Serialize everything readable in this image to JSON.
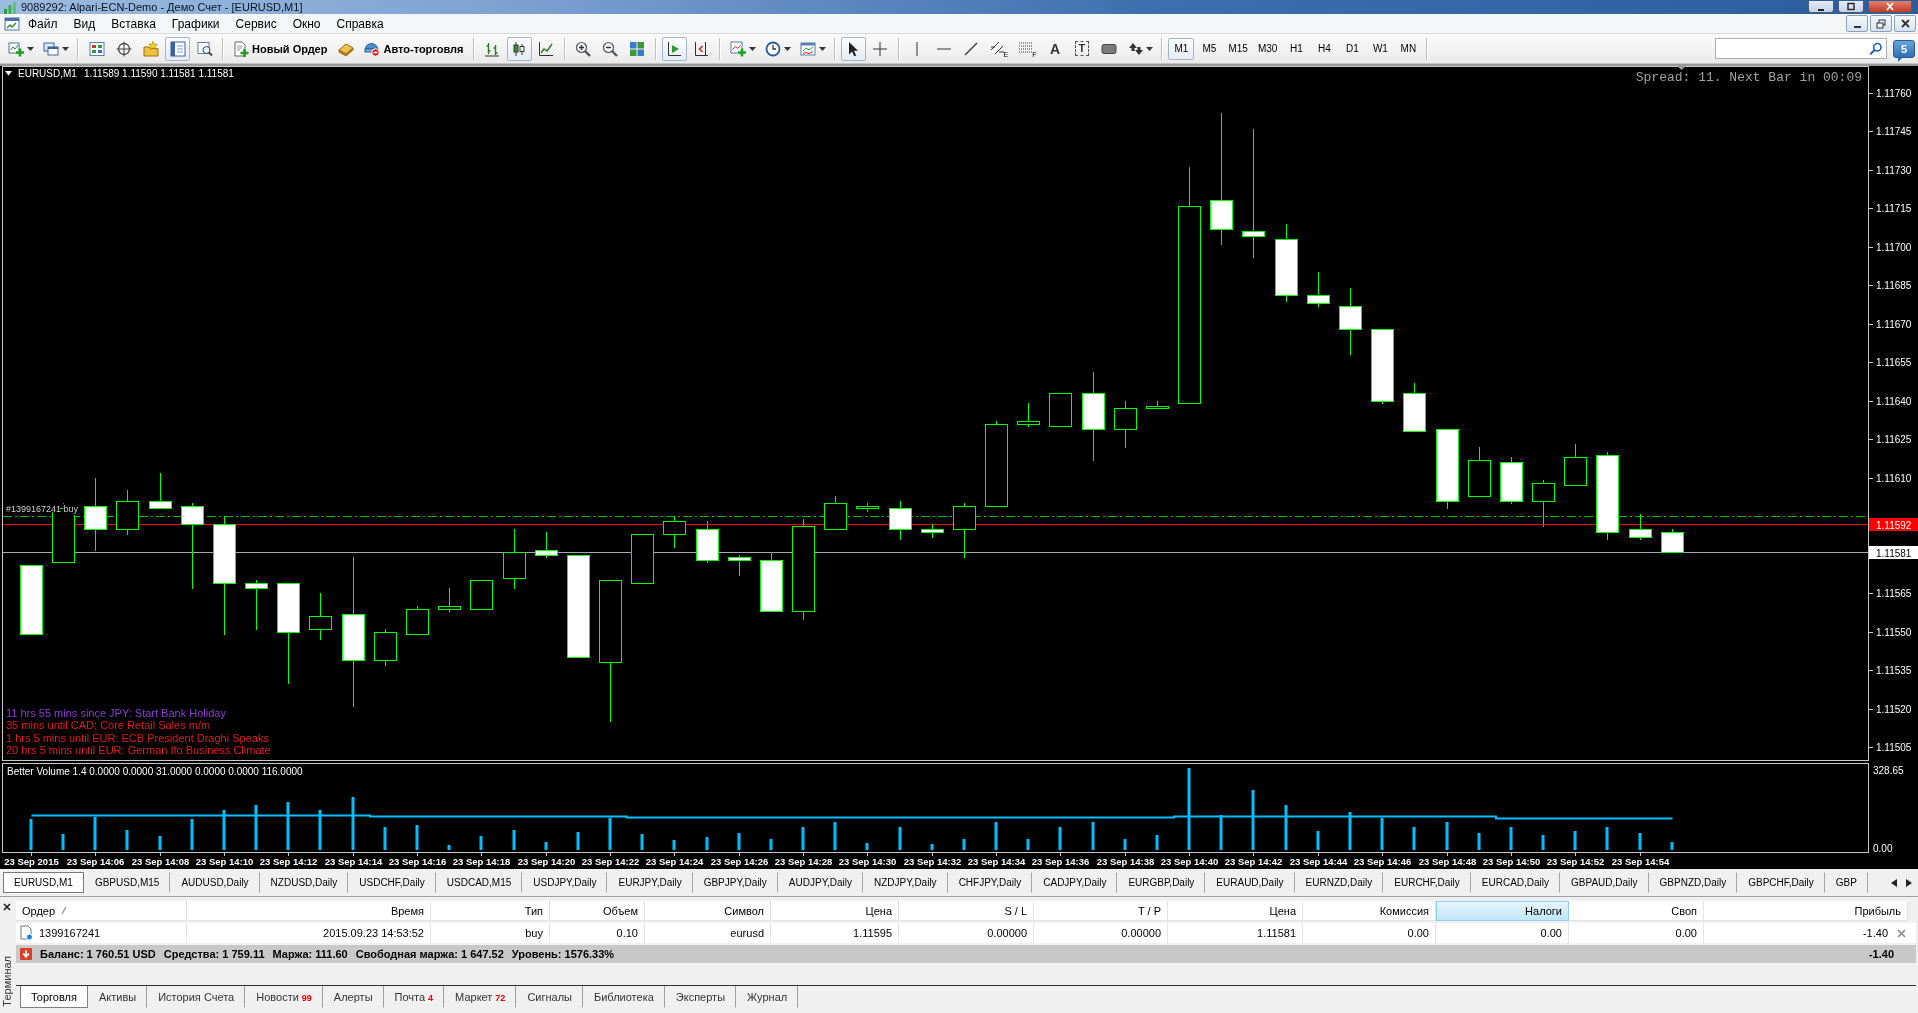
{
  "window": {
    "title": "9089292: Alpari-ECN-Demo - Демо Счет - [EURUSD,M1]"
  },
  "menu": [
    "Файл",
    "Вид",
    "Вставка",
    "Графики",
    "Сервис",
    "Окно",
    "Справка"
  ],
  "toolbar": {
    "items": [
      {
        "kind": "dropdown",
        "pressed": false
      },
      {
        "kind": "dropdown",
        "pressed": false
      },
      {
        "kind": "separator"
      },
      {
        "kind": "icon",
        "pressed": false
      },
      {
        "kind": "icon",
        "pressed": false
      },
      {
        "kind": "icon",
        "pressed": false
      },
      {
        "kind": "icon",
        "pressed": true
      },
      {
        "kind": "icon",
        "pressed": false
      },
      {
        "kind": "separator"
      },
      {
        "kind": "text",
        "label": "Новый Ордер",
        "pressed": false
      },
      {
        "kind": "icon",
        "pressed": false
      },
      {
        "kind": "text",
        "label": "Авто-торговля",
        "pressed": false
      },
      {
        "kind": "separator"
      },
      {
        "kind": "icon",
        "pressed": false
      },
      {
        "kind": "icon",
        "pressed": true
      },
      {
        "kind": "icon",
        "pressed": false
      },
      {
        "kind": "separator"
      },
      {
        "kind": "icon",
        "pressed": false
      },
      {
        "kind": "icon",
        "pressed": false
      },
      {
        "kind": "icon",
        "pressed": false
      },
      {
        "kind": "separator"
      },
      {
        "kind": "icon",
        "pressed": true
      },
      {
        "kind": "icon",
        "pressed": false
      },
      {
        "kind": "separator"
      },
      {
        "kind": "dropdown",
        "pressed": false
      },
      {
        "kind": "dropdown",
        "pressed": false
      },
      {
        "kind": "dropdown",
        "pressed": false
      },
      {
        "kind": "separator"
      },
      {
        "kind": "icon",
        "pressed": true
      },
      {
        "kind": "icon",
        "pressed": false
      },
      {
        "kind": "separator"
      },
      {
        "kind": "icon",
        "pressed": false
      },
      {
        "kind": "icon",
        "pressed": false
      },
      {
        "kind": "icon",
        "pressed": false
      },
      {
        "kind": "icon",
        "label": "E",
        "pressed": false
      },
      {
        "kind": "icon",
        "label": "F",
        "pressed": false
      },
      {
        "kind": "glyph",
        "label": "A",
        "pressed": false
      },
      {
        "kind": "framed-glyph",
        "label": "T",
        "pressed": false
      },
      {
        "kind": "icon",
        "pressed": false
      },
      {
        "kind": "dropdown",
        "pressed": false
      }
    ],
    "timeframes": [
      {
        "label": "M1",
        "selected": true
      },
      {
        "label": "M5",
        "selected": false
      },
      {
        "label": "M15",
        "selected": false
      },
      {
        "label": "M30",
        "selected": false
      },
      {
        "label": "H1",
        "selected": false
      },
      {
        "label": "H4",
        "selected": false
      },
      {
        "label": "D1",
        "selected": false
      },
      {
        "label": "W1",
        "selected": false
      },
      {
        "label": "MN",
        "selected": false
      }
    ],
    "messages_count": "5"
  },
  "chart": {
    "header": {
      "symbol": "EURUSD,M1",
      "prices": "1.11589 1.11590 1.11581 1.11581"
    },
    "info": "Spread: 11. Next Bar in 00:09",
    "news": [
      {
        "text": "11 hrs 55 mins since JPY: Start Bank Holiday",
        "color": "#8c3cd2"
      },
      {
        "text": "35 mins until CAD: Core Retail Sales m/m",
        "color": "#dc1e1e"
      },
      {
        "text": "1 hrs 5 mins until EUR: ECB President Draghi Speaks",
        "color": "#dc1e1e"
      },
      {
        "text": "20 hrs 5 mins until EUR: German Ifo Business Climate",
        "color": "#dc1e1e"
      }
    ],
    "chart_data": [
      {
        "type": "candlestick",
        "x": [
          "2015-09-23T14:04",
          "2015-09-23T14:05",
          "2015-09-23T14:06",
          "2015-09-23T14:07",
          "2015-09-23T14:08",
          "2015-09-23T14:09",
          "2015-09-23T14:10",
          "2015-09-23T14:11",
          "2015-09-23T14:12",
          "2015-09-23T14:13",
          "2015-09-23T14:14",
          "2015-09-23T14:15",
          "2015-09-23T14:16",
          "2015-09-23T14:17",
          "2015-09-23T14:18",
          "2015-09-23T14:19",
          "2015-09-23T14:20",
          "2015-09-23T14:21",
          "2015-09-23T14:22",
          "2015-09-23T14:23",
          "2015-09-23T14:24",
          "2015-09-23T14:25",
          "2015-09-23T14:26",
          "2015-09-23T14:27",
          "2015-09-23T14:28",
          "2015-09-23T14:29",
          "2015-09-23T14:30",
          "2015-09-23T14:31",
          "2015-09-23T14:32",
          "2015-09-23T14:33",
          "2015-09-23T14:34",
          "2015-09-23T14:35",
          "2015-09-23T14:36",
          "2015-09-23T14:37",
          "2015-09-23T14:38",
          "2015-09-23T14:39",
          "2015-09-23T14:40",
          "2015-09-23T14:41",
          "2015-09-23T14:42",
          "2015-09-23T14:43",
          "2015-09-23T14:44",
          "2015-09-23T14:45",
          "2015-09-23T14:46",
          "2015-09-23T14:47",
          "2015-09-23T14:48",
          "2015-09-23T14:49",
          "2015-09-23T14:50",
          "2015-09-23T14:51",
          "2015-09-23T14:52",
          "2015-09-23T14:53",
          "2015-09-23T14:54",
          "2015-09-23T14:55"
        ],
        "ohlc": [
          [
            1.11576,
            1.11576,
            1.11549,
            1.11549
          ],
          [
            1.11577,
            1.116,
            1.11577,
            1.11598
          ],
          [
            1.11599,
            1.1161,
            1.11582,
            1.1159
          ],
          [
            1.1159,
            1.11605,
            1.11588,
            1.11601
          ],
          [
            1.11601,
            1.11612,
            1.11598,
            1.11598
          ],
          [
            1.11599,
            1.116,
            1.11567,
            1.11592
          ],
          [
            1.11592,
            1.11595,
            1.11549,
            1.11569
          ],
          [
            1.11569,
            1.1157,
            1.11551,
            1.11567
          ],
          [
            1.11569,
            1.11569,
            1.1153,
            1.1155
          ],
          [
            1.11551,
            1.11565,
            1.11547,
            1.11556
          ],
          [
            1.11557,
            1.11579,
            1.11521,
            1.11539
          ],
          [
            1.11539,
            1.11551,
            1.11537,
            1.1155
          ],
          [
            1.11549,
            1.1156,
            1.11549,
            1.11559
          ],
          [
            1.11559,
            1.11567,
            1.11558,
            1.1156
          ],
          [
            1.11559,
            1.1157,
            1.11559,
            1.1157
          ],
          [
            1.11571,
            1.1159,
            1.11567,
            1.11581
          ],
          [
            1.11582,
            1.11589,
            1.11579,
            1.1158
          ],
          [
            1.1158,
            1.1158,
            1.1154,
            1.1154
          ],
          [
            1.11538,
            1.1157,
            1.11515,
            1.1157
          ],
          [
            1.11569,
            1.11588,
            1.11569,
            1.11588
          ],
          [
            1.11588,
            1.11595,
            1.11583,
            1.11593
          ],
          [
            1.1159,
            1.11593,
            1.11577,
            1.11578
          ],
          [
            1.11579,
            1.1158,
            1.11572,
            1.11578
          ],
          [
            1.11578,
            1.11581,
            1.11558,
            1.11558
          ],
          [
            1.11558,
            1.11594,
            1.11555,
            1.11591
          ],
          [
            1.1159,
            1.11603,
            1.1159,
            1.116
          ],
          [
            1.11598,
            1.116,
            1.11597,
            1.11599
          ],
          [
            1.11598,
            1.11601,
            1.11586,
            1.1159
          ],
          [
            1.1159,
            1.11592,
            1.11587,
            1.11589
          ],
          [
            1.1159,
            1.116,
            1.11579,
            1.11599
          ],
          [
            1.11599,
            1.11632,
            1.11599,
            1.11631
          ],
          [
            1.11631,
            1.11639,
            1.1163,
            1.11632
          ],
          [
            1.1163,
            1.11643,
            1.1163,
            1.11643
          ],
          [
            1.11643,
            1.11651,
            1.11617,
            1.11629
          ],
          [
            1.11629,
            1.1164,
            1.11622,
            1.11637
          ],
          [
            1.11637,
            1.1164,
            1.11637,
            1.11638
          ],
          [
            1.11639,
            1.11731,
            1.11639,
            1.11716
          ],
          [
            1.11718,
            1.11752,
            1.11701,
            1.11707
          ],
          [
            1.11706,
            1.11746,
            1.11696,
            1.11704
          ],
          [
            1.11703,
            1.11709,
            1.11679,
            1.11681
          ],
          [
            1.11681,
            1.1169,
            1.11677,
            1.11678
          ],
          [
            1.11677,
            1.11684,
            1.11658,
            1.11668
          ],
          [
            1.11668,
            1.11668,
            1.11639,
            1.1164
          ],
          [
            1.11643,
            1.11647,
            1.11628,
            1.11628
          ],
          [
            1.11629,
            1.11629,
            1.11598,
            1.11601
          ],
          [
            1.11603,
            1.11622,
            1.11603,
            1.11617
          ],
          [
            1.11616,
            1.11618,
            1.116,
            1.11601
          ],
          [
            1.11601,
            1.11609,
            1.11591,
            1.11608
          ],
          [
            1.11607,
            1.11623,
            1.11607,
            1.11618
          ],
          [
            1.11619,
            1.1162,
            1.11586,
            1.11589
          ],
          [
            1.1159,
            1.11596,
            1.11586,
            1.11587
          ],
          [
            1.11589,
            1.1159,
            1.11581,
            1.11581
          ]
        ],
        "xlim": [
          "2015-09-23T14:03:07",
          "2015-09-23T15:01:07"
        ],
        "ylim": [
          1.115,
          1.1177
        ],
        "yticks": [
          {
            "value": 1.11505,
            "label": "1.11505"
          },
          {
            "value": 1.1152,
            "label": "1.11520"
          },
          {
            "value": 1.11535,
            "label": "1.11535"
          },
          {
            "value": 1.1155,
            "label": "1.11550"
          },
          {
            "value": 1.11565,
            "label": "1.11565"
          },
          {
            "value": 1.1161,
            "label": "1.11610"
          },
          {
            "value": 1.11625,
            "label": "1.11625"
          },
          {
            "value": 1.1164,
            "label": "1.11640"
          },
          {
            "value": 1.11655,
            "label": "1.11655"
          },
          {
            "value": 1.1167,
            "label": "1.11670"
          },
          {
            "value": 1.11685,
            "label": "1.11685"
          },
          {
            "value": 1.117,
            "label": "1.11700"
          },
          {
            "value": 1.11715,
            "label": "1.11715"
          },
          {
            "value": 1.1173,
            "label": "1.11730"
          },
          {
            "value": 1.11745,
            "label": "1.11745"
          },
          {
            "value": 1.1176,
            "label": "1.11760"
          }
        ],
        "ref_lines": [
          {
            "axis": "y",
            "value": 1.11595,
            "label": "#1399167241 buy",
            "color": "#00c000",
            "line_style": "dashdot"
          },
          {
            "axis": "y",
            "value": 1.11592,
            "label": "1.11592",
            "color": "#ff0000",
            "line_style": "solid"
          },
          {
            "axis": "y",
            "value": 1.11581,
            "label": "1.11581",
            "color": "#a0aab4",
            "line_style": "solid"
          }
        ]
      },
      {
        "type": "bar",
        "title": "Better Volume 1.4 0.0000 0.0000 31.0000 0.0000 0.0000 116.0000",
        "x": [
          "2015-09-23T14:04",
          "2015-09-23T14:05",
          "2015-09-23T14:06",
          "2015-09-23T14:07",
          "2015-09-23T14:08",
          "2015-09-23T14:09",
          "2015-09-23T14:10",
          "2015-09-23T14:11",
          "2015-09-23T14:12",
          "2015-09-23T14:13",
          "2015-09-23T14:14",
          "2015-09-23T14:15",
          "2015-09-23T14:16",
          "2015-09-23T14:17",
          "2015-09-23T14:18",
          "2015-09-23T14:19",
          "2015-09-23T14:20",
          "2015-09-23T14:21",
          "2015-09-23T14:22",
          "2015-09-23T14:23",
          "2015-09-23T14:24",
          "2015-09-23T14:25",
          "2015-09-23T14:26",
          "2015-09-23T14:27",
          "2015-09-23T14:28",
          "2015-09-23T14:29",
          "2015-09-23T14:30",
          "2015-09-23T14:31",
          "2015-09-23T14:32",
          "2015-09-23T14:33",
          "2015-09-23T14:34",
          "2015-09-23T14:35",
          "2015-09-23T14:36",
          "2015-09-23T14:37",
          "2015-09-23T14:38",
          "2015-09-23T14:39",
          "2015-09-23T14:40",
          "2015-09-23T14:41",
          "2015-09-23T14:42",
          "2015-09-23T14:43",
          "2015-09-23T14:44",
          "2015-09-23T14:45",
          "2015-09-23T14:46",
          "2015-09-23T14:47",
          "2015-09-23T14:48",
          "2015-09-23T14:49",
          "2015-09-23T14:50",
          "2015-09-23T14:51",
          "2015-09-23T14:52",
          "2015-09-23T14:53",
          "2015-09-23T14:54",
          "2015-09-23T14:55"
        ],
        "xlim": [
          "2015-09-23T14:03:07",
          "2015-09-23T15:01:07"
        ],
        "xticks": [
          {
            "value": "2015-09-23T14:04",
            "label": "23 Sep 2015"
          },
          {
            "value": "2015-09-23T14:06",
            "label": "23 Sep 14:06"
          },
          {
            "value": "2015-09-23T14:08",
            "label": "23 Sep 14:08"
          },
          {
            "value": "2015-09-23T14:10",
            "label": "23 Sep 14:10"
          },
          {
            "value": "2015-09-23T14:12",
            "label": "23 Sep 14:12"
          },
          {
            "value": "2015-09-23T14:14",
            "label": "23 Sep 14:14"
          },
          {
            "value": "2015-09-23T14:16",
            "label": "23 Sep 14:16"
          },
          {
            "value": "2015-09-23T14:18",
            "label": "23 Sep 14:18"
          },
          {
            "value": "2015-09-23T14:20",
            "label": "23 Sep 14:20"
          },
          {
            "value": "2015-09-23T14:22",
            "label": "23 Sep 14:22"
          },
          {
            "value": "2015-09-23T14:24",
            "label": "23 Sep 14:24"
          },
          {
            "value": "2015-09-23T14:26",
            "label": "23 Sep 14:26"
          },
          {
            "value": "2015-09-23T14:28",
            "label": "23 Sep 14:28"
          },
          {
            "value": "2015-09-23T14:30",
            "label": "23 Sep 14:30"
          },
          {
            "value": "2015-09-23T14:32",
            "label": "23 Sep 14:32"
          },
          {
            "value": "2015-09-23T14:34",
            "label": "23 Sep 14:34"
          },
          {
            "value": "2015-09-23T14:36",
            "label": "23 Sep 14:36"
          },
          {
            "value": "2015-09-23T14:38",
            "label": "23 Sep 14:38"
          },
          {
            "value": "2015-09-23T14:40",
            "label": "23 Sep 14:40"
          },
          {
            "value": "2015-09-23T14:42",
            "label": "23 Sep 14:42"
          },
          {
            "value": "2015-09-23T14:44",
            "label": "23 Sep 14:44"
          },
          {
            "value": "2015-09-23T14:46",
            "label": "23 Sep 14:46"
          },
          {
            "value": "2015-09-23T14:48",
            "label": "23 Sep 14:48"
          },
          {
            "value": "2015-09-23T14:50",
            "label": "23 Sep 14:50"
          },
          {
            "value": "2015-09-23T14:52",
            "label": "23 Sep 14:52"
          },
          {
            "value": "2015-09-23T14:54",
            "label": "23 Sep 14:54"
          }
        ],
        "ylim": [
          0,
          328.65
        ],
        "yticks": [
          {
            "value": 0,
            "label": "0.00"
          },
          {
            "value": 328.65,
            "label": "328.65"
          }
        ],
        "series": [
          {
            "type": "bar",
            "color": "#00bfff",
            "values": [
              121,
              60,
              128,
              79,
              53,
              118,
              156,
              175,
              184,
              156,
              203,
              87,
              96,
              21,
              56,
              79,
              32,
              68,
              125,
              61,
              40,
              49,
              66,
              43,
              89,
              108,
              27,
              89,
              23,
              43,
              108,
              43,
              89,
              108,
              43,
              58,
              317,
              135,
              232,
              174,
              74,
              147,
              124,
              89,
              108,
              66,
              89,
              58,
              74,
              89,
              66,
              31
            ]
          },
          {
            "type": "step",
            "color": "#00bfff",
            "values": [
              137,
              137,
              137,
              137,
              137,
              137,
              137,
              137,
              137,
              137,
              137,
              132,
              132,
              132,
              132,
              132,
              132,
              132,
              132,
              128,
              128,
              128,
              127,
              127,
              127,
              127,
              127,
              127,
              127,
              127,
              127,
              127,
              127,
              127,
              127,
              127,
              130,
              130,
              130,
              130,
              130,
              130,
              130,
              130,
              130,
              130,
              125,
              125,
              125,
              125,
              125,
              125
            ]
          }
        ]
      }
    ]
  },
  "chart_tabs": [
    {
      "label": "EURUSD,M1",
      "selected": true
    },
    {
      "label": "GBPUSD,M15",
      "selected": false
    },
    {
      "label": "AUDUSD,Daily",
      "selected": false
    },
    {
      "label": "NZDUSD,Daily",
      "selected": false
    },
    {
      "label": "USDCHF,Daily",
      "selected": false
    },
    {
      "label": "USDCAD,M15",
      "selected": false
    },
    {
      "label": "USDJPY,Daily",
      "selected": false
    },
    {
      "label": "EURJPY,Daily",
      "selected": false
    },
    {
      "label": "GBPJPY,Daily",
      "selected": false
    },
    {
      "label": "AUDJPY,Daily",
      "selected": false
    },
    {
      "label": "NZDJPY,Daily",
      "selected": false
    },
    {
      "label": "CHFJPY,Daily",
      "selected": false
    },
    {
      "label": "CADJPY,Daily",
      "selected": false
    },
    {
      "label": "EURGBP,Daily",
      "selected": false
    },
    {
      "label": "EURAUD,Daily",
      "selected": false
    },
    {
      "label": "EURNZD,Daily",
      "selected": false
    },
    {
      "label": "EURCHF,Daily",
      "selected": false
    },
    {
      "label": "EURCAD,Daily",
      "selected": false
    },
    {
      "label": "GBPAUD,Daily",
      "selected": false
    },
    {
      "label": "GBPNZD,Daily",
      "selected": false
    },
    {
      "label": "GBPCHF,Daily",
      "selected": false
    },
    {
      "label": "GBP",
      "selected": false
    }
  ],
  "terminal": {
    "title": "Терминал",
    "columns": [
      {
        "label": "Ордер",
        "sorted": true,
        "selected": false
      },
      {
        "label": "Время",
        "sorted": false,
        "selected": false
      },
      {
        "label": "Тип",
        "sorted": false,
        "selected": false
      },
      {
        "label": "Объем",
        "sorted": false,
        "selected": false
      },
      {
        "label": "Символ",
        "sorted": false,
        "selected": false
      },
      {
        "label": "Цена",
        "sorted": false,
        "selected": false
      },
      {
        "label": "S / L",
        "sorted": false,
        "selected": false
      },
      {
        "label": "T / P",
        "sorted": false,
        "selected": false
      },
      {
        "label": "Цена",
        "sorted": false,
        "selected": false
      },
      {
        "label": "Комиссия",
        "sorted": false,
        "selected": false
      },
      {
        "label": "Налоги",
        "sorted": false,
        "selected": true
      },
      {
        "label": "Своп",
        "sorted": false,
        "selected": false
      },
      {
        "label": "Прибыль",
        "sorted": false,
        "selected": false
      }
    ],
    "rows": [
      {
        "cells": [
          "1399167241",
          "2015.09.23 14:53:52",
          "buy",
          "0.10",
          "eurusd",
          "1.11595",
          "0.00000",
          "0.00000",
          "1.11581",
          "0.00",
          "0.00",
          "0.00",
          "-1.40"
        ]
      }
    ],
    "summary": {
      "items": [
        "Баланс: 1 760.51 USD",
        "Средства: 1 759.11",
        "Маржа: 111.60",
        "Свободная маржа: 1 647.52",
        "Уровень: 1576.33%"
      ],
      "total": "-1.40"
    },
    "tabs": [
      {
        "label": "Торговля",
        "selected": true
      },
      {
        "label": "Активы",
        "selected": false
      },
      {
        "label": "История Счета",
        "selected": false
      },
      {
        "label": "Новости",
        "badge": "99",
        "selected": false
      },
      {
        "label": "Алерты",
        "selected": false
      },
      {
        "label": "Почта",
        "badge": "4",
        "selected": false
      },
      {
        "label": "Маркет",
        "badge": "72",
        "selected": false
      },
      {
        "label": "Сигналы",
        "selected": false
      },
      {
        "label": "Библиотека",
        "selected": false
      },
      {
        "label": "Эксперты",
        "selected": false
      },
      {
        "label": "Журнал",
        "selected": false
      }
    ]
  }
}
